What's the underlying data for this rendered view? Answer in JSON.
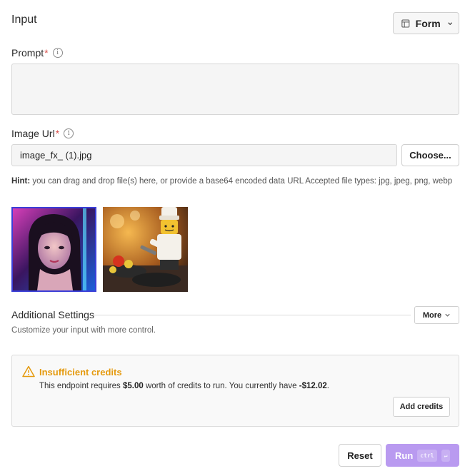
{
  "header": {
    "title": "Input",
    "view_toggle_label": "Form"
  },
  "prompt": {
    "label": "Prompt",
    "required_mark": "*",
    "value": ""
  },
  "image_url": {
    "label": "Image Url",
    "required_mark": "*",
    "value": "image_fx_ (1).jpg",
    "choose_label": "Choose..."
  },
  "hint": {
    "prefix": "Hint:",
    "text": " you can drag and drop file(s) here, or provide a base64 encoded data URL Accepted file types: jpg, jpeg, png, webp"
  },
  "thumbnails": [
    {
      "name": "portrait-thumbnail",
      "selected": true
    },
    {
      "name": "lego-chef-thumbnail",
      "selected": false
    }
  ],
  "additional_settings": {
    "label": "Additional Settings",
    "more_label": "More",
    "subtitle": "Customize your input with more control."
  },
  "credits": {
    "title": "Insufficient credits",
    "text_before": "This endpoint requires ",
    "required_amount": "$5.00",
    "text_middle": " worth of credits to run. You currently have ",
    "current_balance": "-$12.02",
    "text_after": ".",
    "add_label": "Add credits",
    "warning_color": "#e59a0e"
  },
  "actions": {
    "reset_label": "Reset",
    "run_label": "Run",
    "shortcut_key": "ctrl",
    "shortcut_enter": "↵",
    "run_color": "#b99af0"
  }
}
